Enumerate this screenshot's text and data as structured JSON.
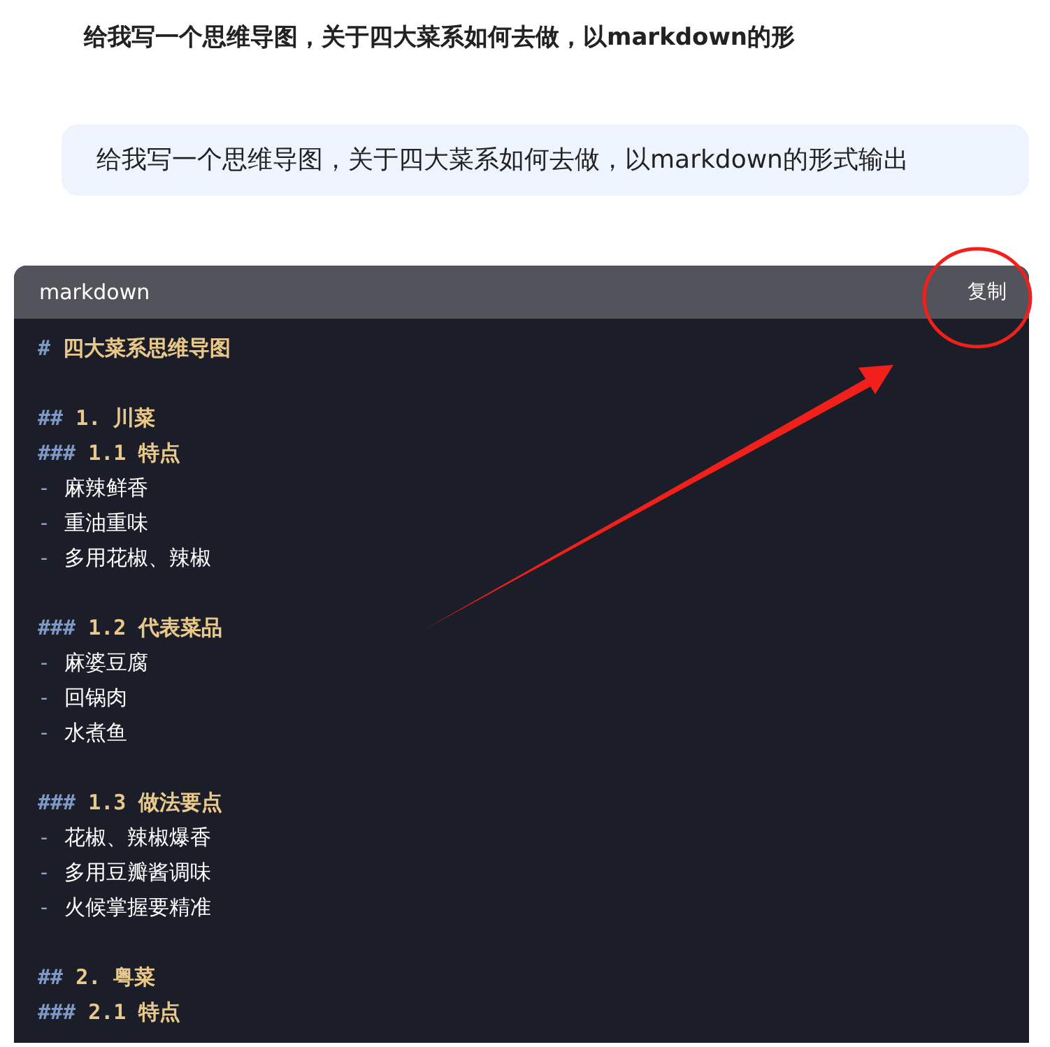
{
  "prompt_title": "给我写一个思维导图，关于四大菜系如何去做，以markdown的形",
  "user_message": "给我写一个思维导图，关于四大菜系如何去做，以markdown的形式输出",
  "code_block": {
    "language": "markdown",
    "copy_button": "复制",
    "lines": [
      {
        "kind": "heading",
        "marker": "#",
        "text": "四大菜系思维导图"
      },
      {
        "kind": "blank"
      },
      {
        "kind": "heading",
        "marker": "##",
        "text": "1. 川菜"
      },
      {
        "kind": "heading",
        "marker": "###",
        "text": "1.1 特点"
      },
      {
        "kind": "bullet",
        "marker": "-",
        "text": "麻辣鲜香"
      },
      {
        "kind": "bullet",
        "marker": "-",
        "text": "重油重味"
      },
      {
        "kind": "bullet",
        "marker": "-",
        "text": "多用花椒、辣椒"
      },
      {
        "kind": "blank"
      },
      {
        "kind": "heading",
        "marker": "###",
        "text": "1.2 代表菜品"
      },
      {
        "kind": "bullet",
        "marker": "-",
        "text": "麻婆豆腐"
      },
      {
        "kind": "bullet",
        "marker": "-",
        "text": "回锅肉"
      },
      {
        "kind": "bullet",
        "marker": "-",
        "text": "水煮鱼"
      },
      {
        "kind": "blank"
      },
      {
        "kind": "heading",
        "marker": "###",
        "text": "1.3 做法要点"
      },
      {
        "kind": "bullet",
        "marker": "-",
        "text": "花椒、辣椒爆香"
      },
      {
        "kind": "bullet",
        "marker": "-",
        "text": "多用豆瓣酱调味"
      },
      {
        "kind": "bullet",
        "marker": "-",
        "text": "火候掌握要精准"
      },
      {
        "kind": "blank"
      },
      {
        "kind": "heading",
        "marker": "##",
        "text": "2. 粤菜"
      },
      {
        "kind": "heading",
        "marker": "###",
        "text": "2.1 特点"
      }
    ]
  }
}
